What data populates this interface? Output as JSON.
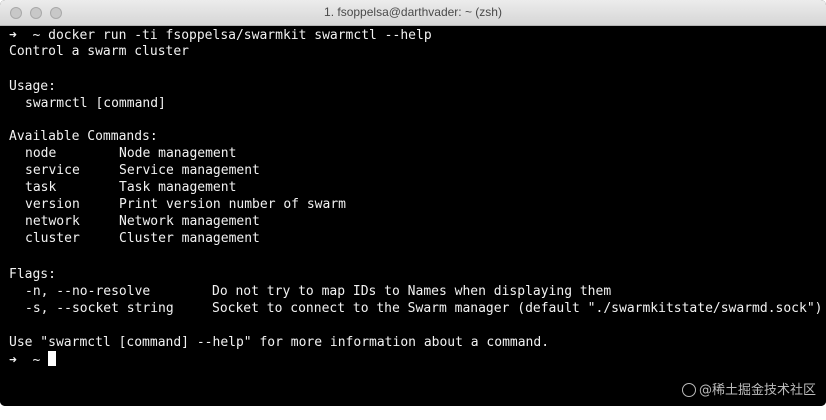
{
  "window": {
    "title": "1. fsoppelsa@darthvader: ~ (zsh)",
    "bg": "#000000",
    "fg": "#f2f2f2"
  },
  "terminal": {
    "prompt_arrow": "➜  ~",
    "command": "docker run -ti fsoppelsa/swarmkit swarmctl --help",
    "description": "Control a swarm cluster",
    "usage_heading": "Usage:",
    "usage_line": "swarmctl [command]",
    "commands_heading": "Available Commands:",
    "commands": [
      {
        "name": "node",
        "desc": "Node management"
      },
      {
        "name": "service",
        "desc": "Service management"
      },
      {
        "name": "task",
        "desc": "Task management"
      },
      {
        "name": "version",
        "desc": "Print version number of swarm"
      },
      {
        "name": "network",
        "desc": "Network management"
      },
      {
        "name": "cluster",
        "desc": "Cluster management"
      }
    ],
    "flags_heading": "Flags:",
    "flags": [
      {
        "flag": "-n, --no-resolve",
        "desc": "Do not try to map IDs to Names when displaying them"
      },
      {
        "flag": "-s, --socket string",
        "desc": "Socket to connect to the Swarm manager (default \"./swarmkitstate/swarmd.sock\")"
      }
    ],
    "footer": "Use \"swarmctl [command] --help\" for more information about a command.",
    "final_prompt": "➜  ~"
  },
  "watermark": "@稀土掘金技术社区"
}
